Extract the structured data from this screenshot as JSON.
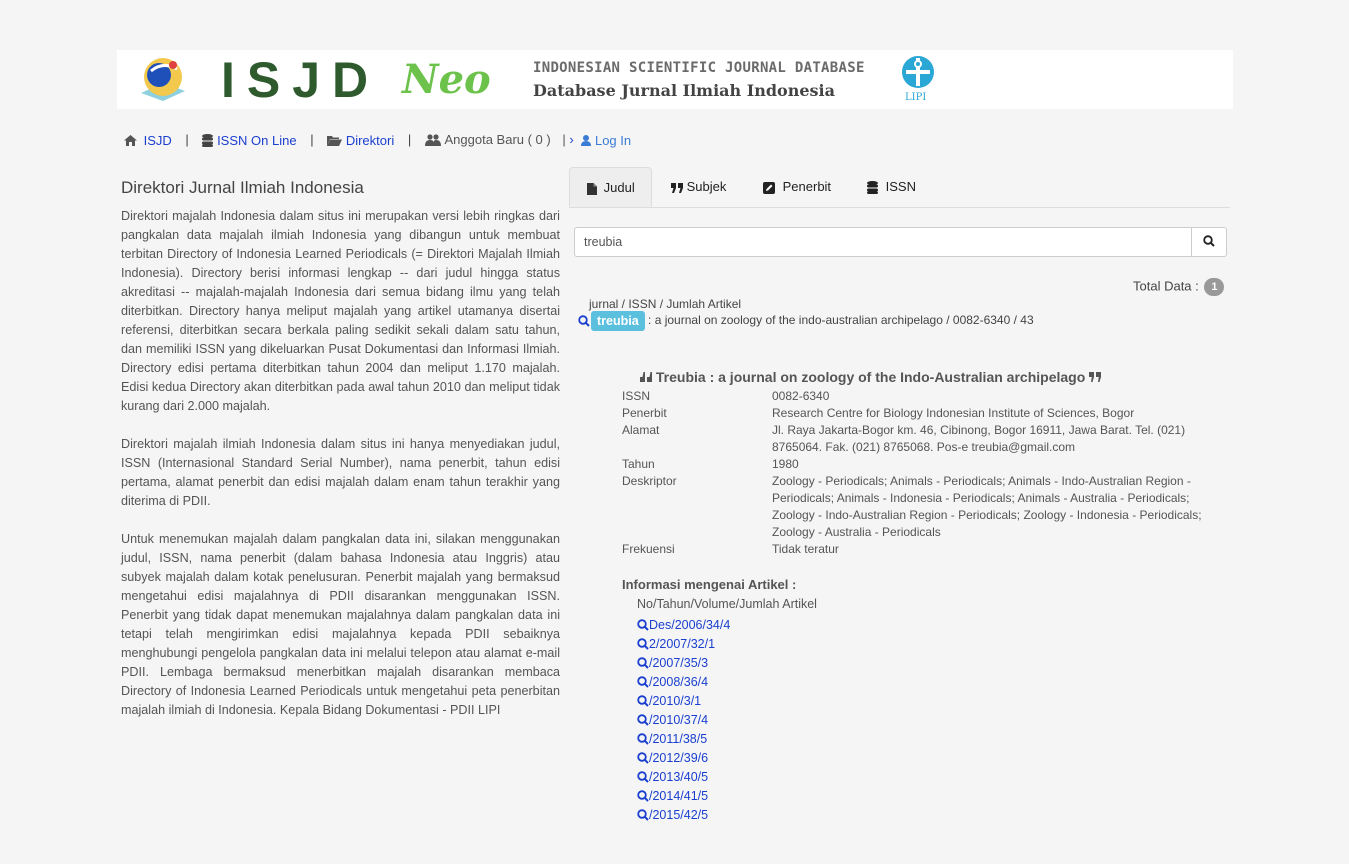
{
  "banner": {
    "logo_main": "ISJD",
    "logo_suffix": "Neo",
    "line1": "INDONESIAN SCIENTIFIC JOURNAL DATABASE",
    "line2": "Database Jurnal Ilmiah Indonesia",
    "lipi": "LIPI"
  },
  "nav": {
    "home": "ISJD",
    "issn_online": "ISSN On Line",
    "direktori": "Direktori",
    "anggota": "Anggota Baru ( 0 )",
    "login": "Log In",
    "separator": "|"
  },
  "left": {
    "title": "Direktori Jurnal Ilmiah Indonesia",
    "paragraphs": [
      "Direktori majalah Indonesia dalam situs ini merupakan versi lebih ringkas dari pangkalan data majalah ilmiah Indonesia yang dibangun untuk membuat terbitan Directory of Indonesia Learned Periodicals (= Direktori Majalah Ilmiah Indonesia). Directory berisi informasi lengkap -- dari judul hingga status akreditasi -- majalah-majalah Indonesia dari semua bidang ilmu yang telah diterbitkan. Directory hanya meliput majalah yang artikel utamanya disertai referensi, diterbitkan secara berkala paling sedikit sekali dalam satu tahun, dan memiliki ISSN yang dikeluarkan Pusat Dokumentasi dan Informasi Ilmiah. Directory edisi pertama diterbitkan tahun 2004 dan meliput 1.170 majalah. Edisi kedua Directory akan diterbitkan pada awal tahun 2010 dan meliput tidak kurang dari 2.000 majalah.",
      "Direktori majalah ilmiah Indonesia dalam situs ini hanya menyediakan judul, ISSN (Internasional Standard Serial Number), nama penerbit, tahun edisi pertama, alamat penerbit dan edisi majalah dalam enam tahun terakhir yang diterima di PDII.",
      "Untuk menemukan majalah dalam pangkalan data ini, silakan menggunakan judul, ISSN, nama penerbit (dalam bahasa Indonesia atau Inggris) atau subyek majalah dalam kotak penelusuran. Penerbit majalah yang bermaksud mengetahui edisi majalahnya di PDII disarankan menggunakan ISSN. Penerbit yang tidak dapat menemukan majalahnya dalam pangkalan data ini tetapi telah mengirimkan edisi majalahnya kepada PDII sebaiknya menghubungi pengelola pangkalan data ini melalui telepon atau alamat e-mail PDII. Lembaga bermaksud menerbitkan majalah disarankan membaca Directory of Indonesia Learned Periodicals untuk mengetahui peta penerbitan majalah ilmiah di Indonesia. Kepala Bidang Dokumentasi - PDII LIPI"
    ]
  },
  "tabs": [
    {
      "label": "Judul",
      "icon": "file-icon",
      "active": true
    },
    {
      "label": "Subjek",
      "icon": "quote-icon",
      "active": false
    },
    {
      "label": "Penerbit",
      "icon": "edit-icon",
      "active": false
    },
    {
      "label": "ISSN",
      "icon": "database-icon",
      "active": false
    }
  ],
  "search": {
    "value": "treubia"
  },
  "results": {
    "total_label": "Total Data :",
    "total": "1",
    "header": "jurnal / ISSN / Jumlah Artikel",
    "item_label": "treubia",
    "item_text": ": a journal on zoology of the indo-australian archipelago / 0082-6340 / 43"
  },
  "detail": {
    "title": "Treubia : a journal on zoology of the Indo-Australian archipelago",
    "fields": [
      {
        "label": "ISSN",
        "value": "0082-6340"
      },
      {
        "label": "Penerbit",
        "value": "Research Centre for Biology Indonesian Institute of Sciences, Bogor"
      },
      {
        "label": "Alamat",
        "value": "Jl. Raya Jakarta-Bogor km. 46, Cibinong, Bogor 16911, Jawa Barat. Tel. (021) 8765064. Fak. (021) 8765068. Pos-e treubia@gmail.com"
      },
      {
        "label": "Tahun",
        "value": "1980"
      },
      {
        "label": "Deskriptor",
        "value": "Zoology - Periodicals; Animals - Periodicals; Animals - Indo-Australian Region - Periodicals; Animals - Indonesia - Periodicals; Animals - Australia - Periodicals; Zoology - Indo-Australian Region - Periodicals; Zoology - Indonesia - Periodicals; Zoology - Australia - Periodicals"
      },
      {
        "label": "Frekuensi",
        "value": "Tidak teratur"
      }
    ]
  },
  "articles": {
    "title": "Informasi mengenai Artikel :",
    "header": "No/Tahun/Volume/Jumlah Artikel",
    "items": [
      "Des/2006/34/4",
      "2/2007/32/1",
      "/2007/35/3",
      "/2008/36/4",
      "/2010/3/1",
      "/2010/37/4",
      "/2011/38/5",
      "/2012/39/6",
      "/2013/40/5",
      "/2014/41/5",
      "/2015/42/5"
    ]
  },
  "colors": {
    "link": "#1a3fcf",
    "label_info": "#5bc0de",
    "badge": "#999999"
  }
}
